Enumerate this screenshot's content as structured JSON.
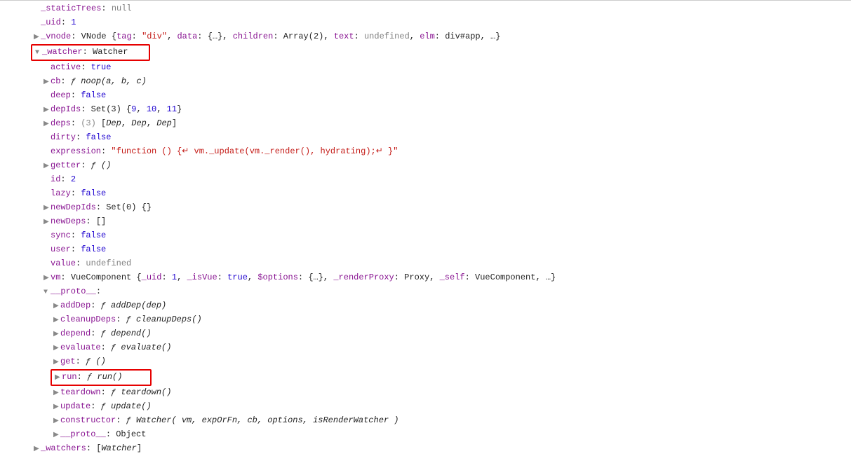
{
  "rows": [
    {
      "indent": 1,
      "tri": "",
      "key": "_staticTrees",
      "rest": [
        {
          "t": "null",
          "c": "null"
        }
      ]
    },
    {
      "indent": 1,
      "tri": "",
      "key": "_uid",
      "rest": [
        {
          "t": "num",
          "c": "1"
        }
      ]
    },
    {
      "indent": 1,
      "tri": "▶",
      "key": "_vnode",
      "rest": [
        {
          "t": "obj",
          "c": "VNode {"
        },
        {
          "t": "key",
          "c": "tag"
        },
        {
          "t": "colon",
          "c": ": "
        },
        {
          "t": "str",
          "c": "\"div\""
        },
        {
          "t": "obj",
          "c": ", "
        },
        {
          "t": "key",
          "c": "data"
        },
        {
          "t": "colon",
          "c": ": "
        },
        {
          "t": "obj",
          "c": "{…}, "
        },
        {
          "t": "key",
          "c": "children"
        },
        {
          "t": "colon",
          "c": ": "
        },
        {
          "t": "obj",
          "c": "Array(2), "
        },
        {
          "t": "key",
          "c": "text"
        },
        {
          "t": "colon",
          "c": ": "
        },
        {
          "t": "undef",
          "c": "undefined"
        },
        {
          "t": "obj",
          "c": ", "
        },
        {
          "t": "key",
          "c": "elm"
        },
        {
          "t": "colon",
          "c": ": "
        },
        {
          "t": "obj",
          "c": "div#app"
        },
        {
          "t": "obj",
          "c": ", …}"
        }
      ]
    },
    {
      "indent": 1,
      "tri": "▼",
      "redbox": true,
      "key": "_watcher",
      "rest": [
        {
          "t": "obj",
          "c": "Watcher"
        }
      ]
    },
    {
      "indent": 2,
      "tri": "",
      "key": "active",
      "rest": [
        {
          "t": "bool",
          "c": "true"
        }
      ]
    },
    {
      "indent": 2,
      "tri": "▶",
      "key": "cb",
      "rest": [
        {
          "t": "f",
          "c": "ƒ "
        },
        {
          "t": "fn",
          "c": "noop(a, b, c)"
        }
      ]
    },
    {
      "indent": 2,
      "tri": "",
      "key": "deep",
      "rest": [
        {
          "t": "bool",
          "c": "false"
        }
      ]
    },
    {
      "indent": 2,
      "tri": "▶",
      "key": "depIds",
      "rest": [
        {
          "t": "obj",
          "c": "Set(3) {"
        },
        {
          "t": "num",
          "c": "9"
        },
        {
          "t": "obj",
          "c": ", "
        },
        {
          "t": "num",
          "c": "10"
        },
        {
          "t": "obj",
          "c": ", "
        },
        {
          "t": "num",
          "c": "11"
        },
        {
          "t": "obj",
          "c": "}"
        }
      ]
    },
    {
      "indent": 2,
      "tri": "▶",
      "key": "deps",
      "rest": [
        {
          "t": "dim",
          "c": "(3) "
        },
        {
          "t": "obj",
          "c": "["
        },
        {
          "t": "fn",
          "c": "Dep"
        },
        {
          "t": "obj",
          "c": ", "
        },
        {
          "t": "fn",
          "c": "Dep"
        },
        {
          "t": "obj",
          "c": ", "
        },
        {
          "t": "fn",
          "c": "Dep"
        },
        {
          "t": "obj",
          "c": "]"
        }
      ]
    },
    {
      "indent": 2,
      "tri": "",
      "key": "dirty",
      "rest": [
        {
          "t": "bool",
          "c": "false"
        }
      ]
    },
    {
      "indent": 2,
      "tri": "",
      "key": "expression",
      "rest": [
        {
          "t": "str",
          "c": "\"function () {↵      vm._update(vm._render(), hydrating);↵    }\""
        }
      ]
    },
    {
      "indent": 2,
      "tri": "▶",
      "key": "getter",
      "rest": [
        {
          "t": "f",
          "c": "ƒ "
        },
        {
          "t": "fn",
          "c": "()"
        }
      ]
    },
    {
      "indent": 2,
      "tri": "",
      "key": "id",
      "rest": [
        {
          "t": "num",
          "c": "2"
        }
      ]
    },
    {
      "indent": 2,
      "tri": "",
      "key": "lazy",
      "rest": [
        {
          "t": "bool",
          "c": "false"
        }
      ]
    },
    {
      "indent": 2,
      "tri": "▶",
      "key": "newDepIds",
      "rest": [
        {
          "t": "obj",
          "c": "Set(0) {}"
        }
      ]
    },
    {
      "indent": 2,
      "tri": "▶",
      "key": "newDeps",
      "rest": [
        {
          "t": "obj",
          "c": "[]"
        }
      ]
    },
    {
      "indent": 2,
      "tri": "",
      "key": "sync",
      "rest": [
        {
          "t": "bool",
          "c": "false"
        }
      ]
    },
    {
      "indent": 2,
      "tri": "",
      "key": "user",
      "rest": [
        {
          "t": "bool",
          "c": "false"
        }
      ]
    },
    {
      "indent": 2,
      "tri": "",
      "key": "value",
      "rest": [
        {
          "t": "undef",
          "c": "undefined"
        }
      ]
    },
    {
      "indent": 2,
      "tri": "▶",
      "key": "vm",
      "rest": [
        {
          "t": "obj",
          "c": "VueComponent {"
        },
        {
          "t": "key",
          "c": "_uid"
        },
        {
          "t": "colon",
          "c": ": "
        },
        {
          "t": "num",
          "c": "1"
        },
        {
          "t": "obj",
          "c": ", "
        },
        {
          "t": "key",
          "c": "_isVue"
        },
        {
          "t": "colon",
          "c": ": "
        },
        {
          "t": "bool",
          "c": "true"
        },
        {
          "t": "obj",
          "c": ", "
        },
        {
          "t": "key",
          "c": "$options"
        },
        {
          "t": "colon",
          "c": ": "
        },
        {
          "t": "obj",
          "c": "{…}, "
        },
        {
          "t": "key",
          "c": "_renderProxy"
        },
        {
          "t": "colon",
          "c": ": "
        },
        {
          "t": "obj",
          "c": "Proxy"
        },
        {
          "t": "obj",
          "c": ", "
        },
        {
          "t": "key",
          "c": "_self"
        },
        {
          "t": "colon",
          "c": ": "
        },
        {
          "t": "obj",
          "c": "VueComponent"
        },
        {
          "t": "obj",
          "c": ", …}"
        }
      ]
    },
    {
      "indent": 2,
      "tri": "▼",
      "key": "__proto__",
      "rest": []
    },
    {
      "indent": 3,
      "tri": "▶",
      "key": "addDep",
      "rest": [
        {
          "t": "f",
          "c": "ƒ "
        },
        {
          "t": "fn",
          "c": "addDep(dep)"
        }
      ]
    },
    {
      "indent": 3,
      "tri": "▶",
      "key": "cleanupDeps",
      "rest": [
        {
          "t": "f",
          "c": "ƒ "
        },
        {
          "t": "fn",
          "c": "cleanupDeps()"
        }
      ]
    },
    {
      "indent": 3,
      "tri": "▶",
      "key": "depend",
      "rest": [
        {
          "t": "f",
          "c": "ƒ "
        },
        {
          "t": "fn",
          "c": "depend()"
        }
      ]
    },
    {
      "indent": 3,
      "tri": "▶",
      "key": "evaluate",
      "rest": [
        {
          "t": "f",
          "c": "ƒ "
        },
        {
          "t": "fn",
          "c": "evaluate()"
        }
      ]
    },
    {
      "indent": 3,
      "tri": "▶",
      "key": "get",
      "rest": [
        {
          "t": "f",
          "c": "ƒ "
        },
        {
          "t": "fn",
          "c": "()"
        }
      ]
    },
    {
      "indent": 3,
      "tri": "▶",
      "redbox": true,
      "key": "run",
      "rest": [
        {
          "t": "f",
          "c": "ƒ "
        },
        {
          "t": "fn",
          "c": "run()"
        }
      ]
    },
    {
      "indent": 3,
      "tri": "▶",
      "key": "teardown",
      "rest": [
        {
          "t": "f",
          "c": "ƒ "
        },
        {
          "t": "fn",
          "c": "teardown()"
        }
      ]
    },
    {
      "indent": 3,
      "tri": "▶",
      "key": "update",
      "rest": [
        {
          "t": "f",
          "c": "ƒ "
        },
        {
          "t": "fn",
          "c": "update()"
        }
      ]
    },
    {
      "indent": 3,
      "tri": "▶",
      "key": "constructor",
      "rest": [
        {
          "t": "f",
          "c": "ƒ "
        },
        {
          "t": "fn",
          "c": "Watcher( vm, expOrFn, cb, options, isRenderWatcher )"
        }
      ]
    },
    {
      "indent": 3,
      "tri": "▶",
      "key": "__proto__",
      "rest": [
        {
          "t": "obj",
          "c": "Object"
        }
      ]
    },
    {
      "indent": 1,
      "tri": "▶",
      "key": "_watchers",
      "rest": [
        {
          "t": "obj",
          "c": "["
        },
        {
          "t": "fn",
          "c": "Watcher"
        },
        {
          "t": "obj",
          "c": "]"
        }
      ]
    }
  ]
}
